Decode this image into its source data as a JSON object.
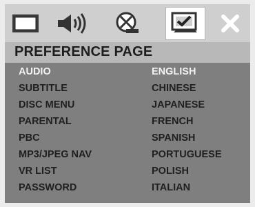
{
  "screen": {
    "title": "PREFERENCE PAGE"
  },
  "tabs": [
    {
      "name": "general-setup",
      "icon": "monitor-icon"
    },
    {
      "name": "audio-setup",
      "icon": "speaker-icon"
    },
    {
      "name": "dolby-setup",
      "icon": "disc-icon"
    },
    {
      "name": "preference",
      "icon": "checkmark-tv-icon",
      "active": true
    },
    {
      "name": "exit",
      "icon": "close-icon"
    }
  ],
  "settings": [
    {
      "label": "AUDIO",
      "selected": true
    },
    {
      "label": "SUBTITLE"
    },
    {
      "label": "DISC MENU"
    },
    {
      "label": "PARENTAL"
    },
    {
      "label": "PBC"
    },
    {
      "label": "MP3/JPEG NAV"
    },
    {
      "label": "VR LIST"
    },
    {
      "label": "PASSWORD"
    }
  ],
  "options": [
    {
      "label": "ENGLISH",
      "selected": true
    },
    {
      "label": "CHINESE"
    },
    {
      "label": "JAPANESE"
    },
    {
      "label": "FRENCH"
    },
    {
      "label": "SPANISH"
    },
    {
      "label": "PORTUGUESE"
    },
    {
      "label": "POLISH"
    },
    {
      "label": "ITALIAN"
    }
  ],
  "colors": {
    "background": "#7f7f7f",
    "icon_bar": "#cfcfcf",
    "header": "#b8b8b8",
    "text": "#202020",
    "highlight_text": "#f2f2f2"
  }
}
